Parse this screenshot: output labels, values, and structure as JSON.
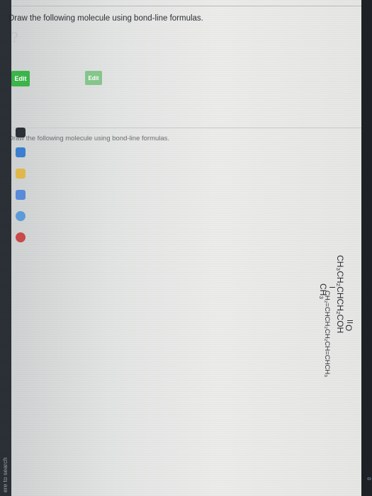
{
  "question1": {
    "prompt": "Draw the following molecule using bond-line formulas.",
    "edit_label": "Edit",
    "formula_main": "CH₃CH₂CHCH₂COH",
    "formula_carbonyl_o": "O",
    "formula_branch": "CH₃"
  },
  "question2": {
    "prompt": "Draw the following molecule using bond-line formulas.",
    "edit_label": "Edit",
    "formula": "CH₂=CHCH₂CH₂CH=CHCH₃"
  },
  "taskbar": {
    "search_placeholder": "ere to search",
    "clock": "0"
  },
  "colors": {
    "edit_button": "#3cb54a",
    "page_bg": "#e6e7e5",
    "taskbar_bg": "#22262d"
  }
}
